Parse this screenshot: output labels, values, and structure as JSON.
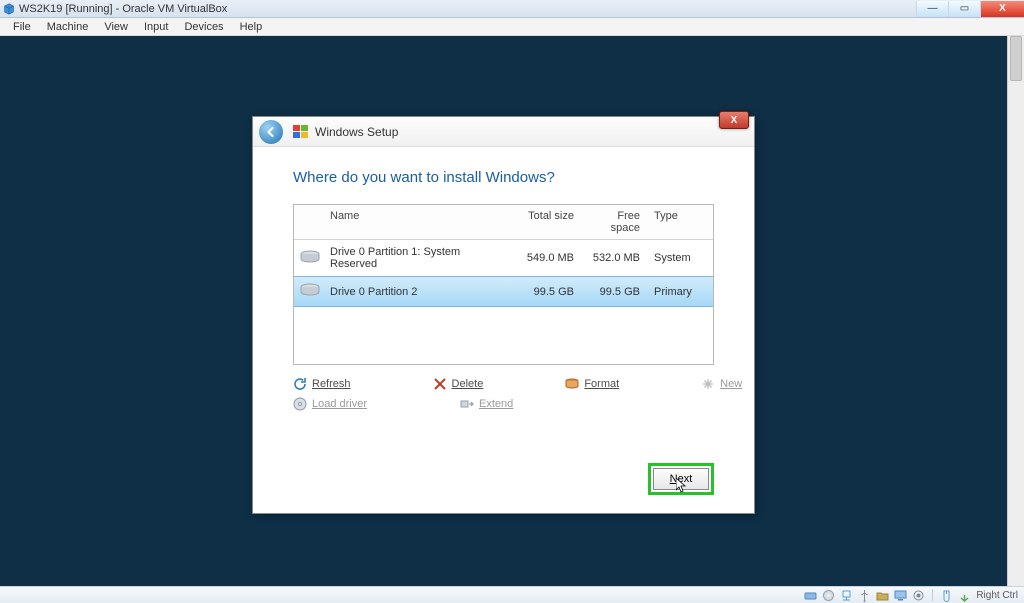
{
  "window": {
    "title": "WS2K19 [Running] - Oracle VM VirtualBox"
  },
  "menu": [
    "File",
    "Machine",
    "View",
    "Input",
    "Devices",
    "Help"
  ],
  "setup": {
    "title": "Windows Setup",
    "heading": "Where do you want to install Windows?",
    "columns": {
      "name": "Name",
      "total": "Total size",
      "free": "Free space",
      "type": "Type"
    },
    "partitions": [
      {
        "name": "Drive 0 Partition 1: System Reserved",
        "total": "549.0 MB",
        "free": "532.0 MB",
        "type": "System",
        "selected": false
      },
      {
        "name": "Drive 0 Partition 2",
        "total": "99.5 GB",
        "free": "99.5 GB",
        "type": "Primary",
        "selected": true
      }
    ],
    "actions": {
      "refresh": "Refresh",
      "delete": "Delete",
      "format": "Format",
      "new": "New",
      "load": "Load driver",
      "extend": "Extend"
    },
    "next": "Next"
  },
  "status": {
    "host_key": "Right Ctrl"
  }
}
